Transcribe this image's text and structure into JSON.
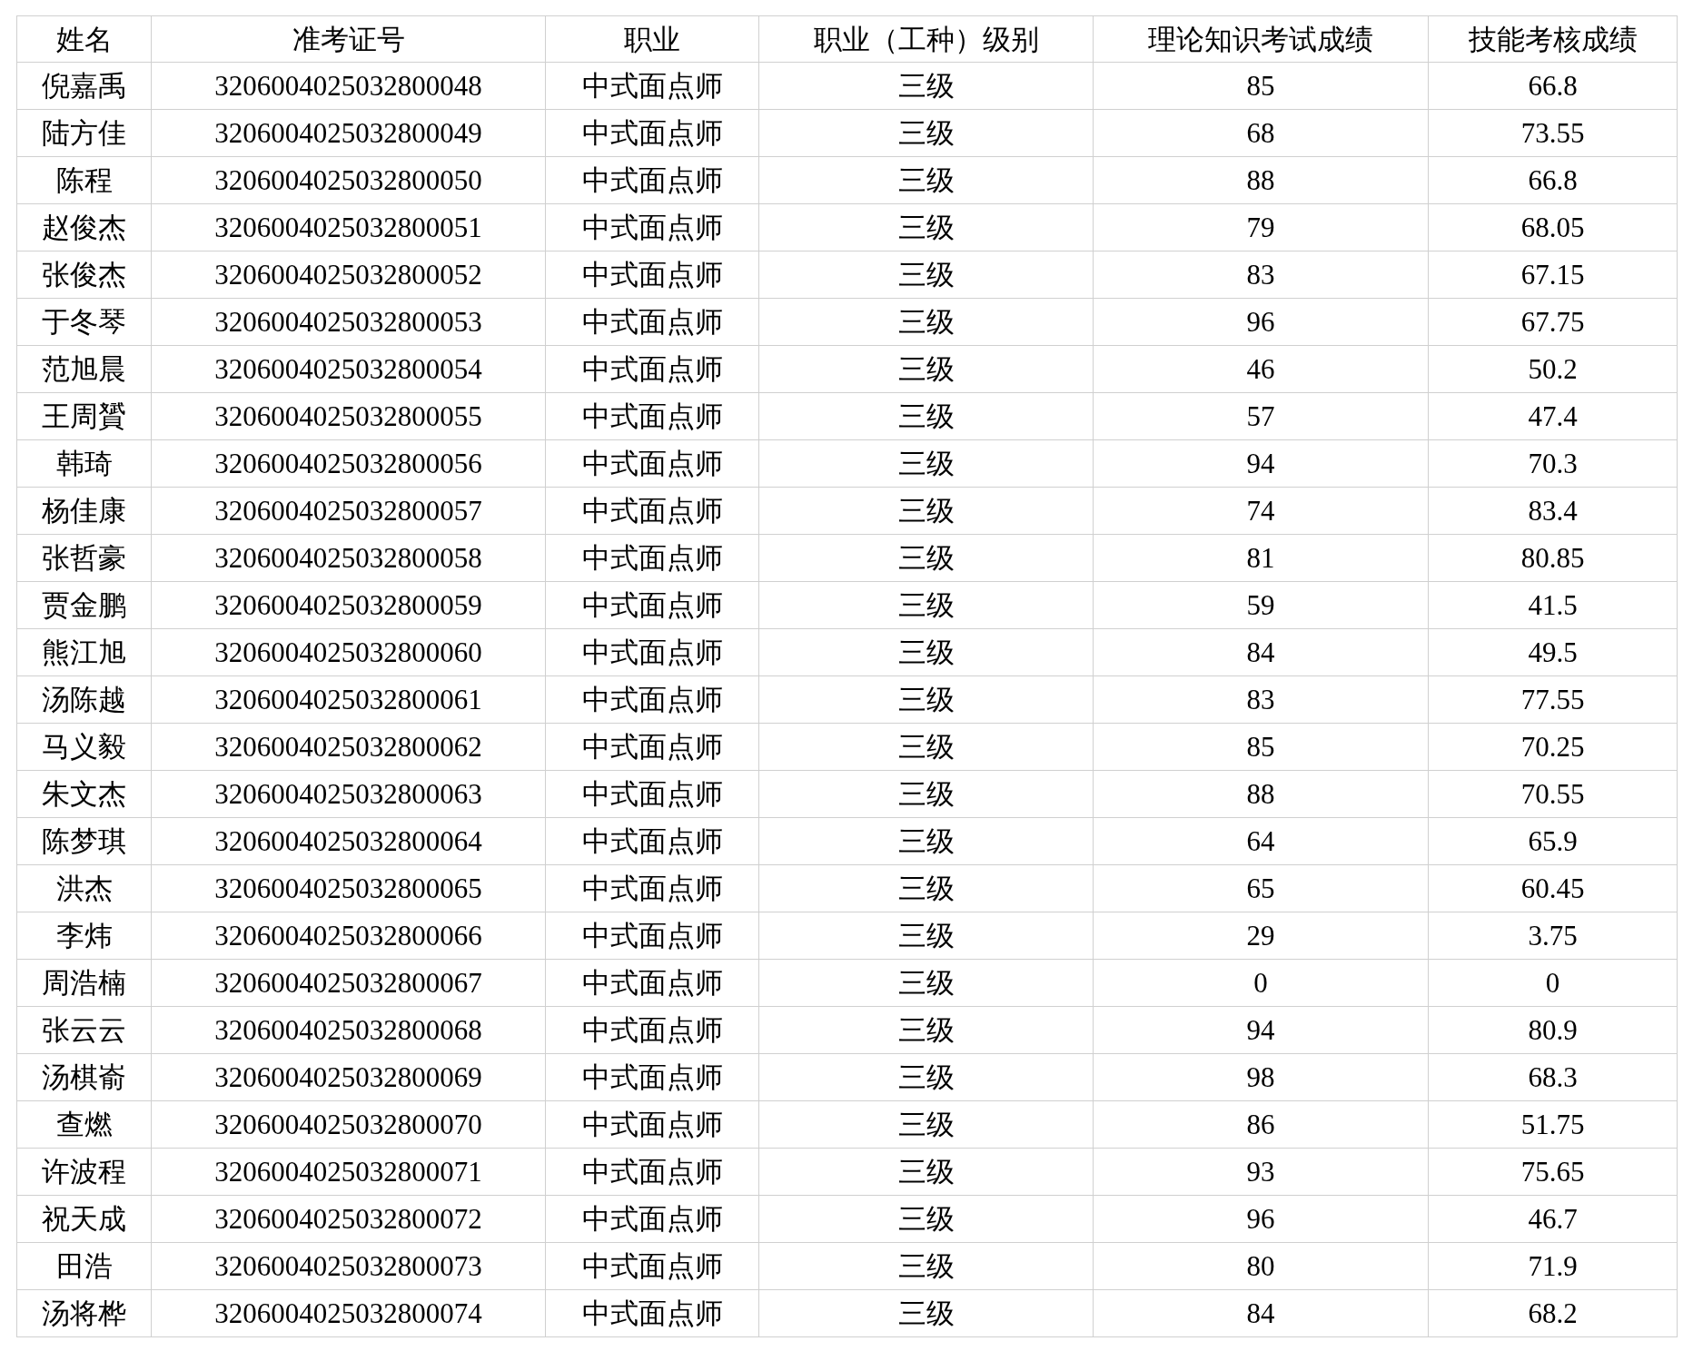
{
  "table": {
    "columns": [
      "姓名",
      "准考证号",
      "职业",
      "职业（工种）级别",
      "理论知识考试成绩",
      "技能考核成绩"
    ],
    "rows": [
      [
        "倪嘉禹",
        "320600402503280004​8",
        "中式面点师",
        "三级",
        "85",
        "66.8"
      ],
      [
        "陆方佳",
        "3206004025032800049",
        "中式面点师",
        "三级",
        "68",
        "73.55"
      ],
      [
        "陈程",
        "3206004025032800050",
        "中式面点师",
        "三级",
        "88",
        "66.8"
      ],
      [
        "赵俊杰",
        "3206004025032800051",
        "中式面点师",
        "三级",
        "79",
        "68.05"
      ],
      [
        "张俊杰",
        "3206004025032800052",
        "中式面点师",
        "三级",
        "83",
        "67.15"
      ],
      [
        "于冬琴",
        "3206004025032800053",
        "中式面点师",
        "三级",
        "96",
        "67.75"
      ],
      [
        "范旭晨",
        "3206004025032800054",
        "中式面点师",
        "三级",
        "46",
        "50.2"
      ],
      [
        "王周贇",
        "3206004025032800055",
        "中式面点师",
        "三级",
        "57",
        "47.4"
      ],
      [
        "韩琦",
        "3206004025032800056",
        "中式面点师",
        "三级",
        "94",
        "70.3"
      ],
      [
        "杨佳康",
        "3206004025032800057",
        "中式面点师",
        "三级",
        "74",
        "83.4"
      ],
      [
        "张哲豪",
        "3206004025032800058",
        "中式面点师",
        "三级",
        "81",
        "80.85"
      ],
      [
        "贾金鹏",
        "3206004025032800059",
        "中式面点师",
        "三级",
        "59",
        "41.5"
      ],
      [
        "熊江旭",
        "3206004025032800060",
        "中式面点师",
        "三级",
        "84",
        "49.5"
      ],
      [
        "汤陈越",
        "3206004025032800061",
        "中式面点师",
        "三级",
        "83",
        "77.55"
      ],
      [
        "马义毅",
        "3206004025032800062",
        "中式面点师",
        "三级",
        "85",
        "70.25"
      ],
      [
        "朱文杰",
        "3206004025032800063",
        "中式面点师",
        "三级",
        "88",
        "70.55"
      ],
      [
        "陈梦琪",
        "3206004025032800064",
        "中式面点师",
        "三级",
        "64",
        "65.9"
      ],
      [
        "洪杰",
        "3206004025032800065",
        "中式面点师",
        "三级",
        "65",
        "60.45"
      ],
      [
        "李炜",
        "3206004025032800066",
        "中式面点师",
        "三级",
        "29",
        "3.75"
      ],
      [
        "周浩楠",
        "3206004025032800067",
        "中式面点师",
        "三级",
        "0",
        "0"
      ],
      [
        "张云云",
        "3206004025032800068",
        "中式面点师",
        "三级",
        "94",
        "80.9"
      ],
      [
        "汤棋嵛",
        "3206004025032800069",
        "中式面点师",
        "三级",
        "98",
        "68.3"
      ],
      [
        "查燃",
        "3206004025032800070",
        "中式面点师",
        "三级",
        "86",
        "51.75"
      ],
      [
        "许波程",
        "3206004025032800071",
        "中式面点师",
        "三级",
        "93",
        "75.65"
      ],
      [
        "祝天成",
        "3206004025032800072",
        "中式面点师",
        "三级",
        "96",
        "46.7"
      ],
      [
        "田浩",
        "3206004025032800073",
        "中式面点师",
        "三级",
        "80",
        "71.9"
      ],
      [
        "汤将桦",
        "3206004025032800074",
        "中式面点师",
        "三级",
        "84",
        "68.2"
      ]
    ]
  }
}
